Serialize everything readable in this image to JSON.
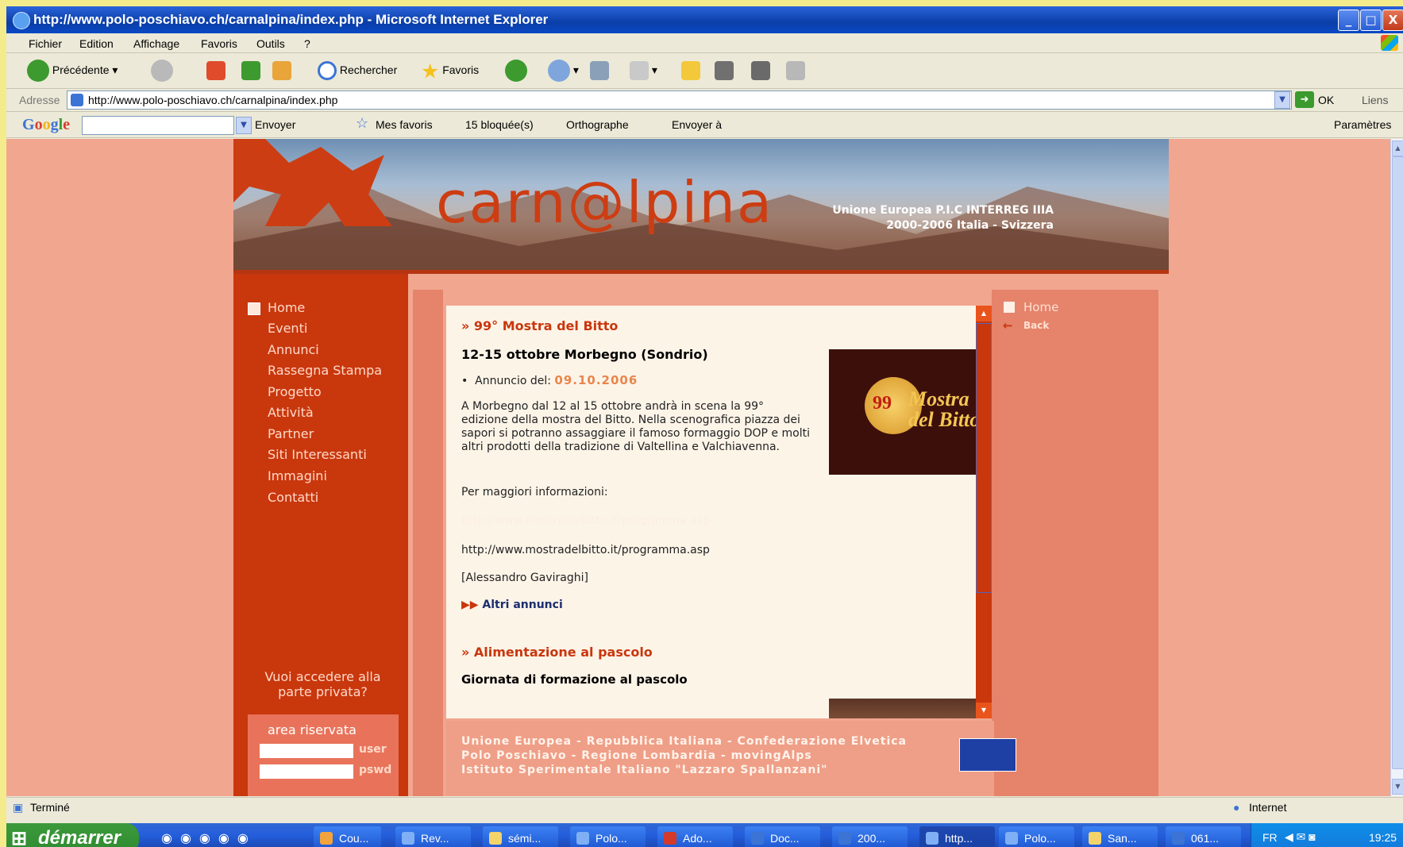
{
  "window": {
    "title": "http://www.polo-poschiavo.ch/carnalpina/index.php - Microsoft Internet Explorer",
    "min_label": "_",
    "max_label": "□",
    "close_label": "X"
  },
  "menu": [
    "Fichier",
    "Edition",
    "Affichage",
    "Favoris",
    "Outils",
    "?"
  ],
  "toolbar": {
    "back_label": "Précédente",
    "search_label": "Rechercher",
    "favorites_label": "Favoris"
  },
  "address": {
    "label": "Adresse",
    "url": "http://www.polo-poschiavo.ch/carnalpina/index.php",
    "ok_label": "OK",
    "links_label": "Liens"
  },
  "googlebar": {
    "logo": "Google",
    "send_label": "Envoyer",
    "favorites_label": "Mes favoris",
    "blocked_label": "15 bloquée(s)",
    "spell_label": "Orthographe",
    "sendto_label": "Envoyer à",
    "settings_label": "Paramètres"
  },
  "site": {
    "logo_text": "carn@lpina",
    "banner_line1": "Unione Europea P.I.C INTERREG IIIA",
    "banner_line2": "2000-2006  Italia - Svizzera",
    "nav": [
      "Home",
      "Eventi",
      "Annunci",
      "Rassegna Stampa",
      "Progetto",
      "Attività",
      "Partner",
      "Siti Interessanti",
      "Immagini",
      "Contatti"
    ],
    "private_prompt": "Vuoi accedere alla parte privata?",
    "area_title": "area riservata",
    "user_label": "user",
    "pswd_label": "pswd",
    "right_home": "Home",
    "right_back": "Back"
  },
  "article1": {
    "title": "» 99° Mostra del Bitto",
    "subtitle": "12-15 ottobre Morbegno (Sondrio)",
    "announce_label": "Annuncio del:",
    "announce_date": "09.10.2006",
    "body": "A Morbegno dal 12 al 15 ottobre andrà in scena la 99° edizione della mostra del Bitto. Nella scenografica piazza dei sapori si potranno assaggiare il famoso formaggio DOP e molti altri prodotti della tradizione di Valtellina e Valchiavenna.",
    "more_info": "Per maggiori informazioni:",
    "link_hidden": "http://www.mostradelbitto.it/programma.asp",
    "url": "http://www.mostradelbitto.it/programma.asp",
    "author": "[Alessandro Gaviraghi]",
    "other_label": "Altri annunci",
    "image_number": "99",
    "image_text": "Mostra del Bitto"
  },
  "article2": {
    "title": "» Alimentazione al pascolo",
    "subtitle": "Giornata di formazione al pascolo"
  },
  "footer": {
    "line1": "Unione Europea - Repubblica Italiana - Confederazione Elvetica",
    "line2": "Polo Poschiavo - Regione Lombardia - movingAlps",
    "line3": "Istituto Sperimentale Italiano \"Lazzaro Spallanzani\""
  },
  "status": {
    "left": "Terminé",
    "zone": "Internet"
  },
  "taskbar": {
    "start_label": "démarrer",
    "tasks": [
      "Cou...",
      "Rev...",
      "sémi...",
      "Polo...",
      "Ado...",
      "Doc...",
      "200...",
      "http...",
      "Polo...",
      "San...",
      "061..."
    ],
    "lang": "FR",
    "clock": "19:25"
  }
}
